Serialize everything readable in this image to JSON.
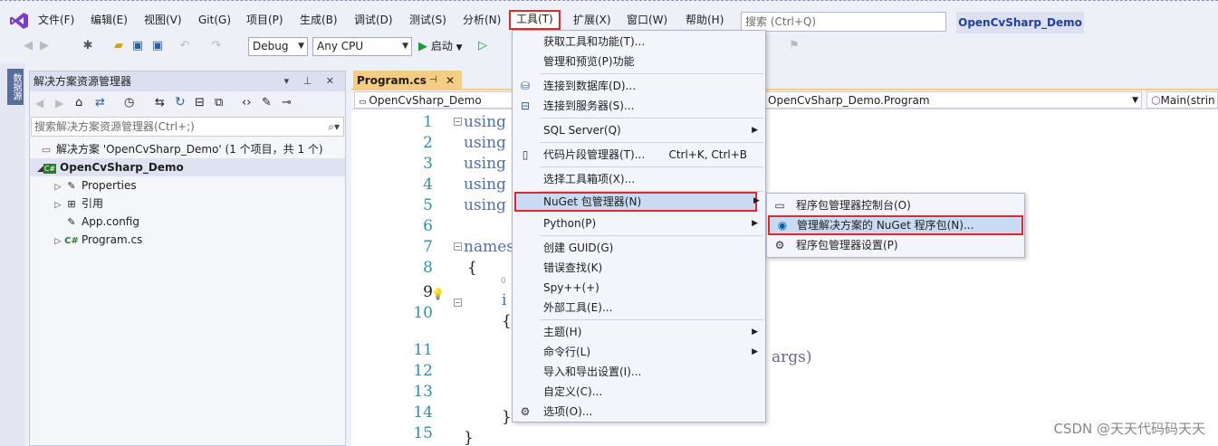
{
  "menubar": {
    "items": [
      "文件(F)",
      "编辑(E)",
      "视图(V)",
      "Git(G)",
      "项目(P)",
      "生成(B)",
      "调试(D)",
      "测试(S)",
      "分析(N)",
      "工具(T)",
      "扩展(X)",
      "窗口(W)",
      "帮助(H)"
    ],
    "search_placeholder": "搜索 (Ctrl+Q)",
    "solution_name": "OpenCvSharp_Demo"
  },
  "toolbar": {
    "config": "Debug",
    "platform": "Any CPU",
    "start_label": "启动"
  },
  "side_strip": {
    "label": "数据源"
  },
  "solution_explorer": {
    "title": "解决方案资源管理器",
    "search_placeholder": "搜索解决方案资源管理器(Ctrl+;)",
    "tree": {
      "solution": "解决方案 'OpenCvSharp_Demo' (1 个项目，共 1 个)",
      "project": "OpenCvSharp_Demo",
      "properties": "Properties",
      "references": "引用",
      "app_config": "App.config",
      "program_cs": "Program.cs"
    }
  },
  "editor": {
    "tab_label": "Program.cs",
    "nav_project": "OpenCvSharp_Demo",
    "nav_class": "OpenCvSharp_Demo.Program",
    "nav_member": "Main(strin",
    "line_numbers": [
      "1",
      "2",
      "3",
      "4",
      "5",
      "6",
      "7",
      "8",
      "9",
      "10",
      "11",
      "12",
      "13",
      "14",
      "15"
    ],
    "code": {
      "l1": "using",
      "l2": "using",
      "l3": "using",
      "l4": "using",
      "l5": "using",
      "l7": "names",
      "l8": "{",
      "l9": "i",
      "l10": "{",
      "l11": "args)",
      "l14": "}",
      "l15": "}",
      "refs_hint": "0"
    }
  },
  "tools_menu": {
    "items": [
      {
        "label": "获取工具和功能(T)..."
      },
      {
        "label": "管理和预览(P)功能"
      },
      {
        "label": "连接到数据库(D)..."
      },
      {
        "label": "连接到服务器(S)..."
      },
      {
        "label": "SQL Server(Q)"
      },
      {
        "label": "代码片段管理器(T)...",
        "shortcut": "Ctrl+K, Ctrl+B"
      },
      {
        "label": "选择工具箱项(X)..."
      },
      {
        "label": "NuGet 包管理器(N)"
      },
      {
        "label": "Python(P)"
      },
      {
        "label": "创建 GUID(G)"
      },
      {
        "label": "错误查找(K)"
      },
      {
        "label": "Spy++(+)"
      },
      {
        "label": "外部工具(E)..."
      },
      {
        "label": "主题(H)"
      },
      {
        "label": "命令行(L)"
      },
      {
        "label": "导入和导出设置(I)..."
      },
      {
        "label": "自定义(C)..."
      },
      {
        "label": "选项(O)..."
      }
    ]
  },
  "nuget_submenu": {
    "items": [
      {
        "label": "程序包管理器控制台(O)"
      },
      {
        "label": "管理解决方案的 NuGet 程序包(N)..."
      },
      {
        "label": "程序包管理器设置(P)"
      }
    ]
  },
  "watermark": "CSDN @天天代码码天天",
  "colors": {
    "highlight_border": "#e0282d",
    "menu_highlight": "#c9dbf3",
    "accent": "#1e3fa8"
  }
}
